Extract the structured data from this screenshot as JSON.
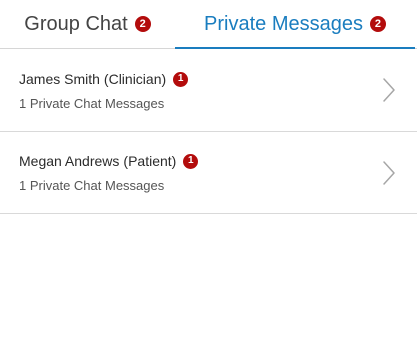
{
  "tabs": [
    {
      "label": "Group Chat",
      "badge": "2",
      "active": false
    },
    {
      "label": "Private Messages",
      "badge": "2",
      "active": true
    }
  ],
  "conversations": [
    {
      "name": "James Smith",
      "role": "(Clinician)",
      "badge": "1",
      "subtitle": "1 Private Chat Messages"
    },
    {
      "name": "Megan Andrews",
      "role": "(Patient)",
      "badge": "1",
      "subtitle": "1 Private Chat Messages"
    }
  ],
  "colors": {
    "accent": "#1a7dbf",
    "badge": "#b30c0c",
    "divider": "#d9d9d9"
  },
  "icons": {
    "row_action": "chevron-right-icon"
  }
}
